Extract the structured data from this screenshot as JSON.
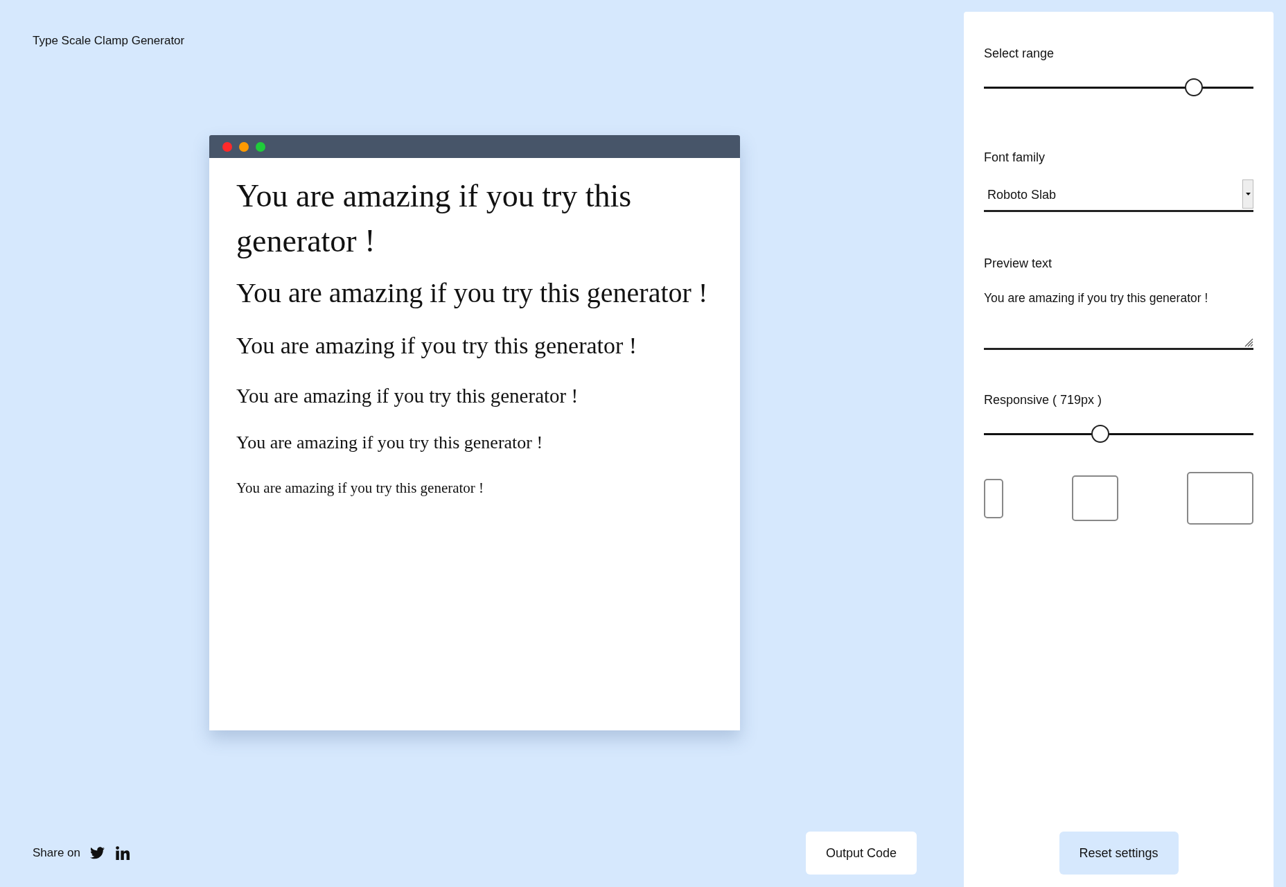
{
  "title": "Type Scale Clamp Generator",
  "preview": {
    "lines": [
      "You are amazing if you try this generator !",
      "You are amazing if you try this generator !",
      "You are amazing if you try this generator !",
      "You are amazing if you try this generator !",
      "You are amazing if you try this generator !",
      "You are amazing if you try this generator !"
    ]
  },
  "share": {
    "label": "Share on"
  },
  "output_button": "Output Code",
  "controls": {
    "select_range": {
      "label": "Select range",
      "level": 0.78
    },
    "font_family": {
      "label": "Font family",
      "value": "Roboto Slab"
    },
    "preview_text": {
      "label": "Preview text",
      "value": "You are amazing if you try this generator !"
    },
    "responsive": {
      "label": "Responsive ( 719px )",
      "level": 0.433
    }
  },
  "reset_button": "Reset settings"
}
